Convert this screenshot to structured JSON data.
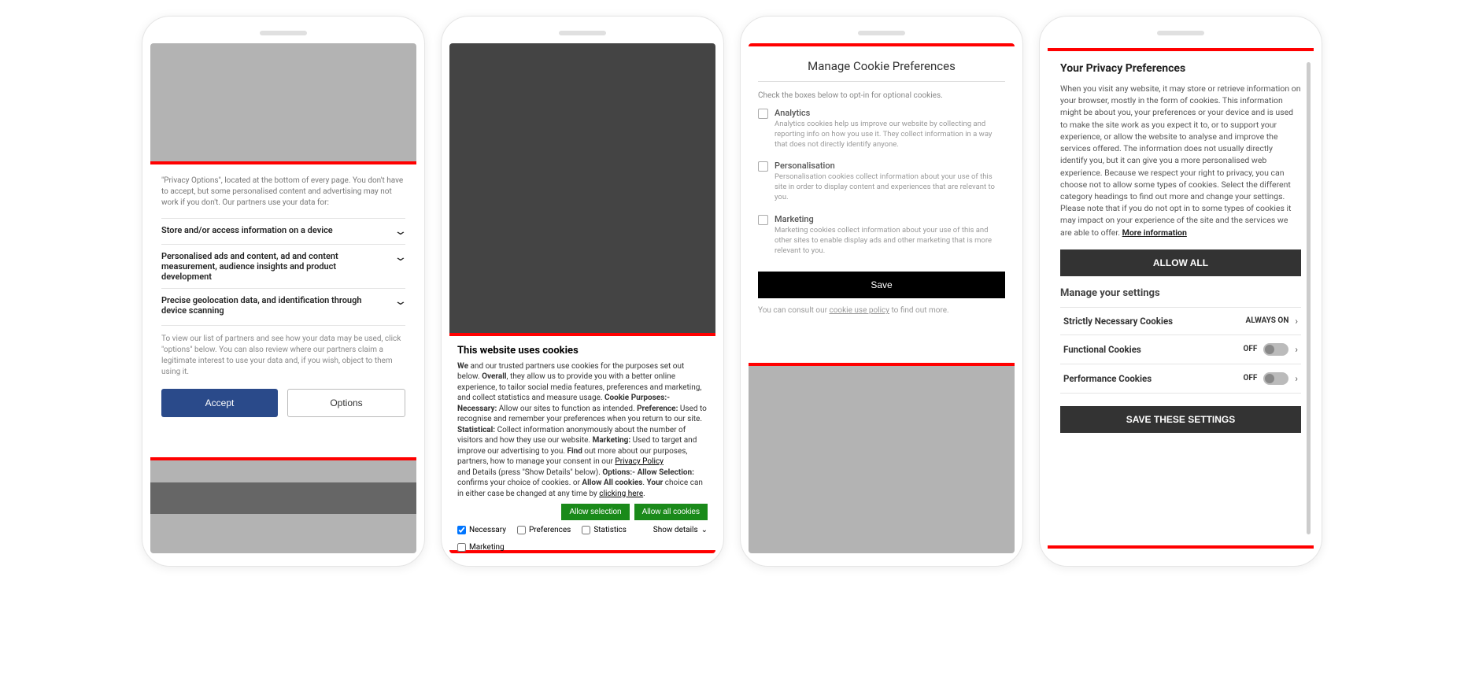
{
  "phone1": {
    "intro": "\"Privacy Options\", located at the bottom of every page. You don't have to accept, but some personalised content and advertising may not work if you don't. Our partners use your data for:",
    "items": [
      "Store and/or access information on a device",
      "Personalised ads and content, ad and content measurement, audience insights and product development",
      "Precise geolocation data, and identification through device scanning"
    ],
    "footer": "To view our list of partners and see how your data may be used, click \"options\" below. You can also review where our partners claim a legitimate interest to use your data and, if you wish, object to them using it.",
    "accept": "Accept",
    "options": "Options"
  },
  "phone2": {
    "title": "This website uses cookies",
    "allow_selection": "Allow selection",
    "allow_all": "Allow all cookies",
    "necessary": "Necessary",
    "preferences": "Preferences",
    "statistics": "Statistics",
    "marketing": "Marketing",
    "show_details": "Show details"
  },
  "phone3": {
    "title": "Manage Cookie Preferences",
    "intro": "Check the boxes below to opt-in for optional cookies.",
    "opts": [
      {
        "title": "Analytics",
        "desc": "Analytics cookies help us improve our website by collecting and reporting info on how you use it. They collect information in a way that does not directly identify anyone."
      },
      {
        "title": "Personalisation",
        "desc": "Personalisation cookies collect information about your use of this site in order to display content and experiences that are relevant to you."
      },
      {
        "title": "Marketing",
        "desc": "Marketing cookies collect information about your use of this and other sites to enable display ads and other marketing that is more relevant to you."
      }
    ],
    "save": "Save",
    "footer_pre": "You can consult our ",
    "footer_link": "cookie use policy",
    "footer_post": " to find out more."
  },
  "phone4": {
    "title": "Your Privacy Preferences",
    "text": "When you visit any website, it may store or retrieve information on your browser, mostly in the form of cookies. This information might be about you, your preferences or your device and is used to make the site work as you expect it to, or to support your experience, or allow the website to analyse and improve the services offered. The information does not usually directly identify you, but it can give you a more personalised web experience. Because we respect your right to privacy, you can choose not to allow some types of cookies. Select the different category headings to find out more and change your settings. Please note that if you do not opt in to some types of cookies it may impact on your experience of the site and the services we are able to offer. ",
    "more": "More information",
    "allow_all": "ALLOW ALL",
    "manage": "Manage your settings",
    "rows": [
      {
        "label": "Strictly Necessary Cookies",
        "state": "ALWAYS ON"
      },
      {
        "label": "Functional Cookies",
        "state": "OFF"
      },
      {
        "label": "Performance Cookies",
        "state": "OFF"
      }
    ],
    "save": "SAVE THESE SETTINGS"
  }
}
